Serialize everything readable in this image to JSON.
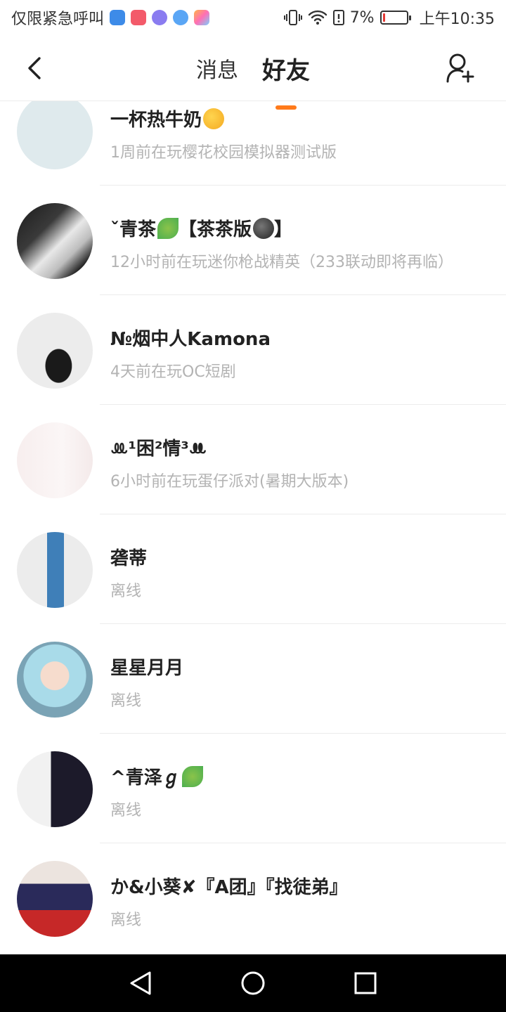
{
  "status_bar": {
    "emergency_text": "仅限紧急呼叫",
    "battery_percent": "7%",
    "time": "上午10:35",
    "app_icons": [
      "shield-app-icon",
      "vivo-app-icon",
      "music-app-icon",
      "browser-app-icon",
      "gallery-app-icon"
    ],
    "battery_level": 0.07
  },
  "header": {
    "tabs": [
      {
        "label": "消息",
        "active": false
      },
      {
        "label": "好友",
        "active": true
      }
    ]
  },
  "friends": [
    {
      "name": "一杯热牛奶",
      "emoji": "upside-down-face",
      "status": "1周前在玩樱花校园模拟器测试版"
    },
    {
      "name": "ˇ青茶",
      "emoji": "leaf",
      "name_suffix": "【茶茶版",
      "name_emoji2": "dark-face",
      "name_end": "】",
      "status": "12小时前在玩迷你枪战精英（233联动即将再临）"
    },
    {
      "name": "№烟中人Kamona",
      "status": "4天前在玩OC短剧"
    },
    {
      "name": "ꔛ¹困²情³ꔚ",
      "status": "6小时前在玩蛋仔派对(暑期大版本)"
    },
    {
      "name": "砻蒂",
      "status": "离线"
    },
    {
      "name": "星星月月",
      "status": "离线"
    },
    {
      "name": "^青泽ℊ",
      "emoji": "leaf",
      "status": "离线"
    },
    {
      "name": "か&小葵✘『A团』『找徒弟』",
      "status": "离线"
    }
  ],
  "colors": {
    "accent": "#ff7a1a",
    "name_text": "#222222",
    "status_text": "#b3b3b3",
    "divider": "#ececec"
  }
}
